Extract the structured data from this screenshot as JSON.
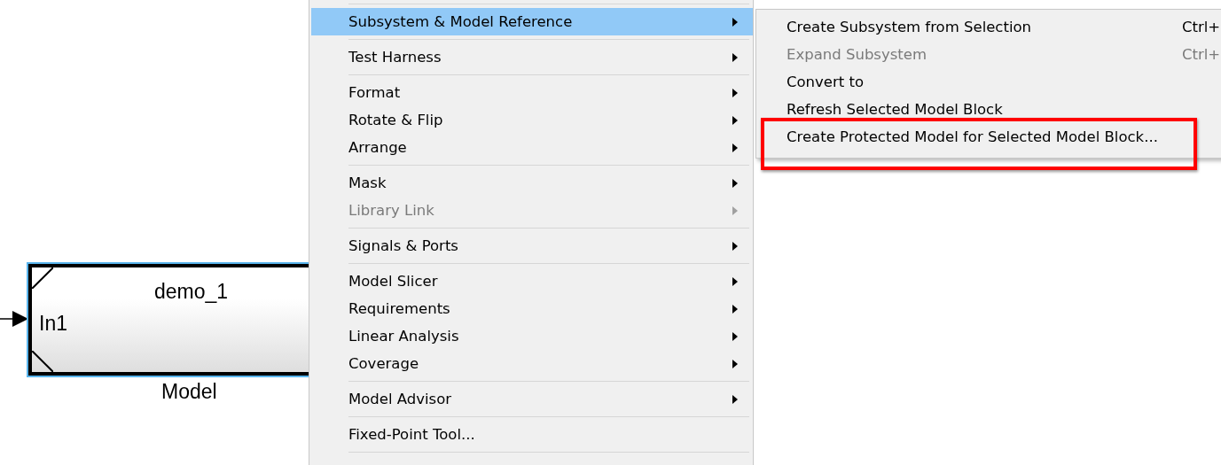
{
  "model_block": {
    "name": "demo_1",
    "input_port": "In1",
    "caption": "Model",
    "selected": true
  },
  "context_menu": {
    "items": [
      {
        "kind": "separator"
      },
      {
        "kind": "item",
        "label": "Subsystem & Model Reference",
        "has_submenu": true,
        "disabled": false,
        "selected": true
      },
      {
        "kind": "separator"
      },
      {
        "kind": "item",
        "label": "Test Harness",
        "has_submenu": true,
        "disabled": false,
        "selected": false
      },
      {
        "kind": "separator"
      },
      {
        "kind": "item",
        "label": "Format",
        "has_submenu": true,
        "disabled": false,
        "selected": false
      },
      {
        "kind": "item",
        "label": "Rotate & Flip",
        "has_submenu": true,
        "disabled": false,
        "selected": false
      },
      {
        "kind": "item",
        "label": "Arrange",
        "has_submenu": true,
        "disabled": false,
        "selected": false
      },
      {
        "kind": "separator"
      },
      {
        "kind": "item",
        "label": "Mask",
        "has_submenu": true,
        "disabled": false,
        "selected": false
      },
      {
        "kind": "item",
        "label": "Library Link",
        "has_submenu": true,
        "disabled": true,
        "selected": false
      },
      {
        "kind": "separator"
      },
      {
        "kind": "item",
        "label": "Signals & Ports",
        "has_submenu": true,
        "disabled": false,
        "selected": false
      },
      {
        "kind": "separator"
      },
      {
        "kind": "item",
        "label": "Model Slicer",
        "has_submenu": true,
        "disabled": false,
        "selected": false
      },
      {
        "kind": "item",
        "label": "Requirements",
        "has_submenu": true,
        "disabled": false,
        "selected": false
      },
      {
        "kind": "item",
        "label": "Linear Analysis",
        "has_submenu": true,
        "disabled": false,
        "selected": false
      },
      {
        "kind": "item",
        "label": "Coverage",
        "has_submenu": true,
        "disabled": false,
        "selected": false
      },
      {
        "kind": "separator"
      },
      {
        "kind": "item",
        "label": "Model Advisor",
        "has_submenu": true,
        "disabled": false,
        "selected": false
      },
      {
        "kind": "separator"
      },
      {
        "kind": "item",
        "label": "Fixed-Point Tool...",
        "has_submenu": false,
        "disabled": false,
        "selected": false
      },
      {
        "kind": "separator"
      }
    ]
  },
  "submenu": {
    "items": [
      {
        "label": "Create Subsystem from Selection",
        "shortcut": "Ctrl+",
        "disabled": false,
        "highlighted": false
      },
      {
        "label": "Expand Subsystem",
        "shortcut": "Ctrl+",
        "disabled": true,
        "highlighted": false
      },
      {
        "label": "Convert to",
        "disabled": false,
        "highlighted": false
      },
      {
        "label": "Refresh Selected Model Block",
        "disabled": false,
        "highlighted": false
      },
      {
        "label": "Create Protected Model for Selected Model Block...",
        "disabled": false,
        "highlighted": true
      }
    ]
  }
}
